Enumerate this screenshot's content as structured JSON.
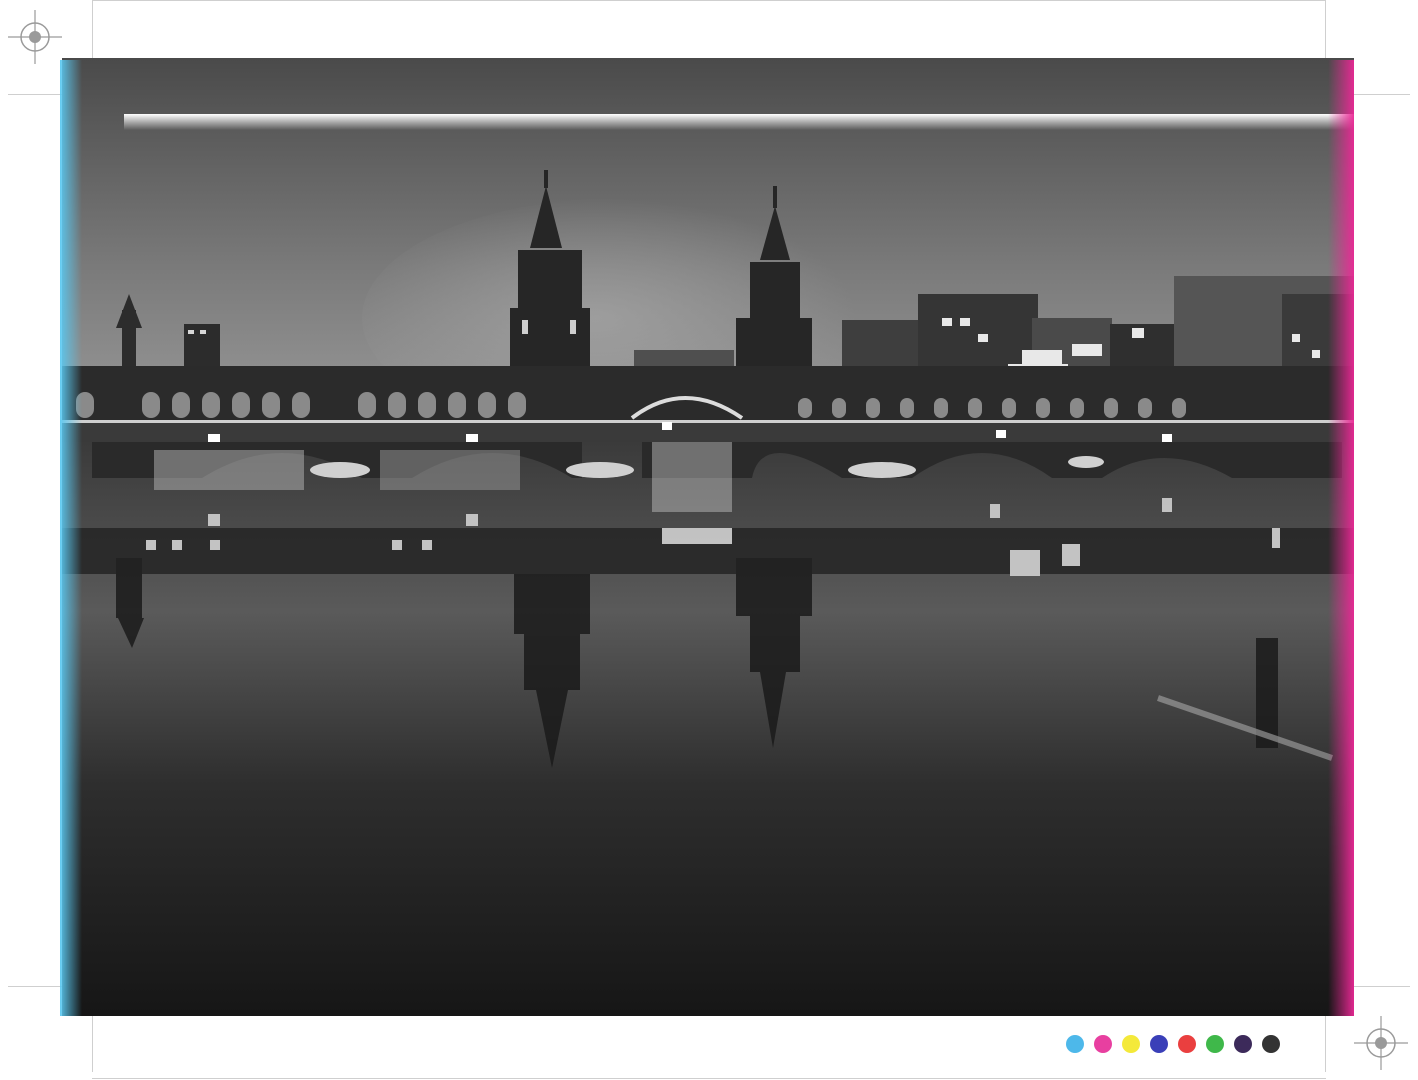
{
  "photo": {
    "subject": "oberbaum-bridge-night-reflection",
    "tone": "black-and-white"
  },
  "edges": {
    "left_tint": "#5ac8f0",
    "right_tint": "#eb2896"
  },
  "swatches": [
    {
      "name": "cyan",
      "color": "#4db8ea"
    },
    {
      "name": "magenta",
      "color": "#e83fa0"
    },
    {
      "name": "yellow",
      "color": "#f4e93a"
    },
    {
      "name": "blue-overlap",
      "color": "#3a3fb8"
    },
    {
      "name": "red",
      "color": "#ea3f3f"
    },
    {
      "name": "green",
      "color": "#3fb84a"
    },
    {
      "name": "mixed-overlap",
      "color": "#3c2a5a"
    },
    {
      "name": "black",
      "color": "#333333"
    }
  ]
}
